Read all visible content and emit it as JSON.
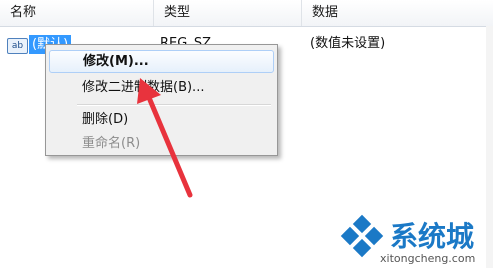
{
  "columns": {
    "name": "名称",
    "type": "类型",
    "data": "数据"
  },
  "row": {
    "icon_text": "ab",
    "name": "(默认)",
    "type": "REG_SZ",
    "data": "(数值未设置)"
  },
  "context_menu": {
    "items": [
      {
        "label": "修改(M)..."
      },
      {
        "label": "修改二进制数据(B)..."
      },
      {
        "label": "删除(D)"
      },
      {
        "label": "重命名(R)"
      }
    ]
  },
  "watermark": {
    "text": "系统城",
    "url": "xitongcheng.com"
  },
  "colors": {
    "selection": "#3399ff",
    "arrow": "#e8333d",
    "watermark_blue": "#1b79c6"
  }
}
